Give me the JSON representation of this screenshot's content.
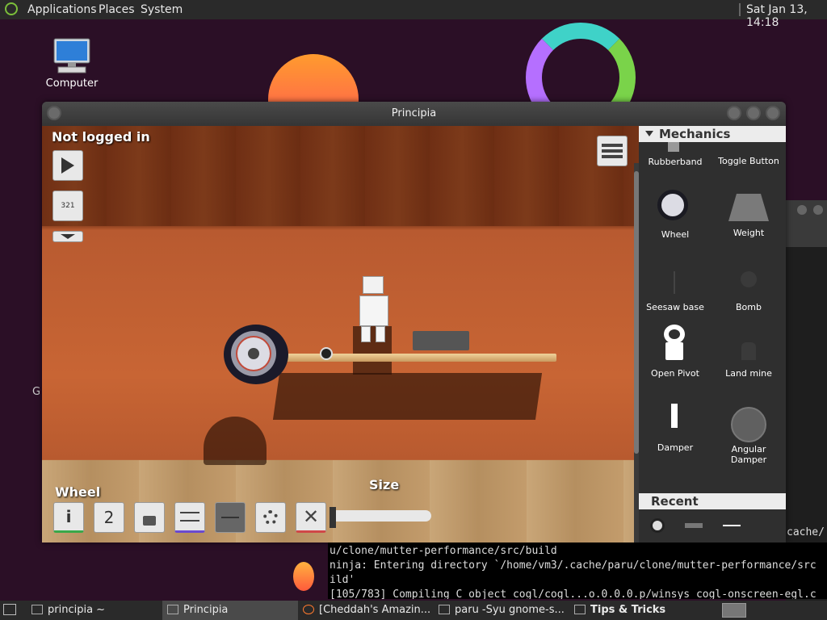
{
  "topbar": {
    "menus": [
      "Applications",
      "Places",
      "System"
    ],
    "clock": "Sat Jan 13, 14:18"
  },
  "desktop": {
    "computer_label": "Computer",
    "partial_text": "G"
  },
  "window": {
    "title": "Principia"
  },
  "game": {
    "login_status": "Not logged in",
    "layer_button_label": "321",
    "selected_label": "Wheel",
    "size_label": "Size",
    "toolbar_number": "2",
    "info_label": "i"
  },
  "panel": {
    "category": "Mechanics",
    "items": [
      "Rubberband",
      "Toggle Button",
      "Wheel",
      "Weight",
      "Seesaw base",
      "Bomb",
      "Open Pivot",
      "Land mine",
      "Damper",
      "Angular Damper"
    ],
    "recent_label": "Recent"
  },
  "terminal": {
    "lines": [
      "u/clone/mutter-performance/src/build",
      "ninja: Entering directory `/home/vm3/.cache/paru/clone/mutter-performance/src",
      "ild'",
      "[105/783] Compiling C object cogl/cogl...o.0.0.0.p/winsys_cogl-onscreen-egl.c"
    ],
    "side_text": "cache/"
  },
  "taskbar": {
    "tasks": [
      "principia ~",
      "Principia",
      "[Cheddah's Amazin...",
      "paru -Syu gnome-s...",
      "Tips & Tricks"
    ]
  }
}
